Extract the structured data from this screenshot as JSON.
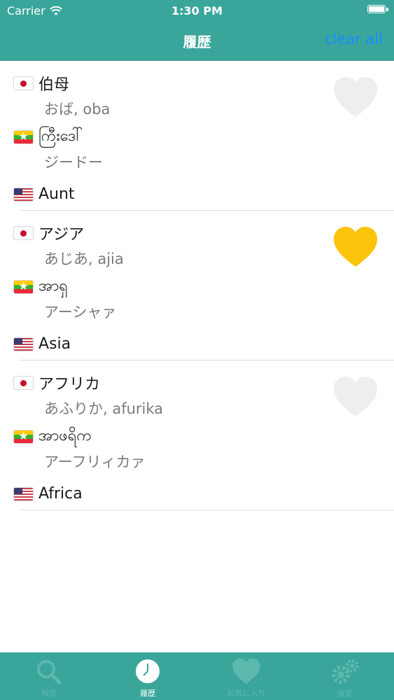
{
  "status_bar": {
    "carrier": "Carrier",
    "time": "1:30 PM"
  },
  "nav": {
    "title": "履歴",
    "action": "clear all"
  },
  "entries": [
    {
      "ja_word": "伯母",
      "ja_reading": "おば, oba",
      "my_word": "ကြီးဒေါ်",
      "my_reading": "ジードー",
      "en_word": "Aunt",
      "favorite": false
    },
    {
      "ja_word": "アジア",
      "ja_reading": "あじあ, ajia",
      "my_word": "အာရှ",
      "my_reading": "アーシャァ",
      "en_word": "Asia",
      "favorite": true
    },
    {
      "ja_word": "アフリカ",
      "ja_reading": "あふりか, afurika",
      "my_word": "အာဖရိက",
      "my_reading": "アーフリィカァ",
      "en_word": "Africa",
      "favorite": false
    }
  ],
  "tabs": [
    {
      "label": "検索",
      "icon": "search-icon",
      "active": false
    },
    {
      "label": "履歴",
      "icon": "clock-icon",
      "active": true
    },
    {
      "label": "お気に入り",
      "icon": "heart-icon",
      "active": false
    },
    {
      "label": "設定",
      "icon": "gear-icon",
      "active": false
    }
  ],
  "colors": {
    "bar": "#3aa69b",
    "favorite_on": "#fcc30b",
    "favorite_off": "#eeeef0",
    "action": "#1a8cff"
  }
}
